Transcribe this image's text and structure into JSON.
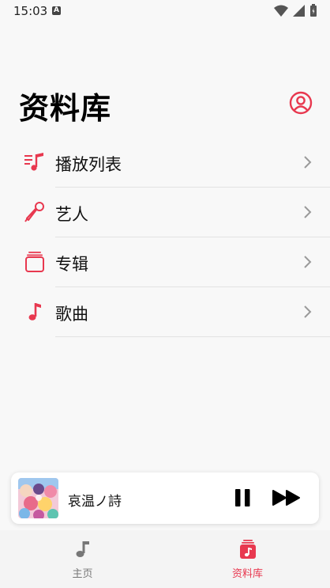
{
  "status": {
    "time": "15:03",
    "a_badge": "A"
  },
  "header": {
    "title": "资料库"
  },
  "library": {
    "items": [
      {
        "label": "播放列表",
        "icon": "playlist-icon"
      },
      {
        "label": "艺人",
        "icon": "microphone-icon"
      },
      {
        "label": "专辑",
        "icon": "album-stack-icon"
      },
      {
        "label": "歌曲",
        "icon": "music-note-icon"
      }
    ]
  },
  "player": {
    "track_title": "哀温ノ詩",
    "state": "playing"
  },
  "tabs": [
    {
      "label": "主页",
      "icon": "home-note-icon",
      "active": false
    },
    {
      "label": "资料库",
      "icon": "library-icon",
      "active": true
    }
  ],
  "colors": {
    "accent": "#e8384f",
    "inactive": "#777777"
  }
}
